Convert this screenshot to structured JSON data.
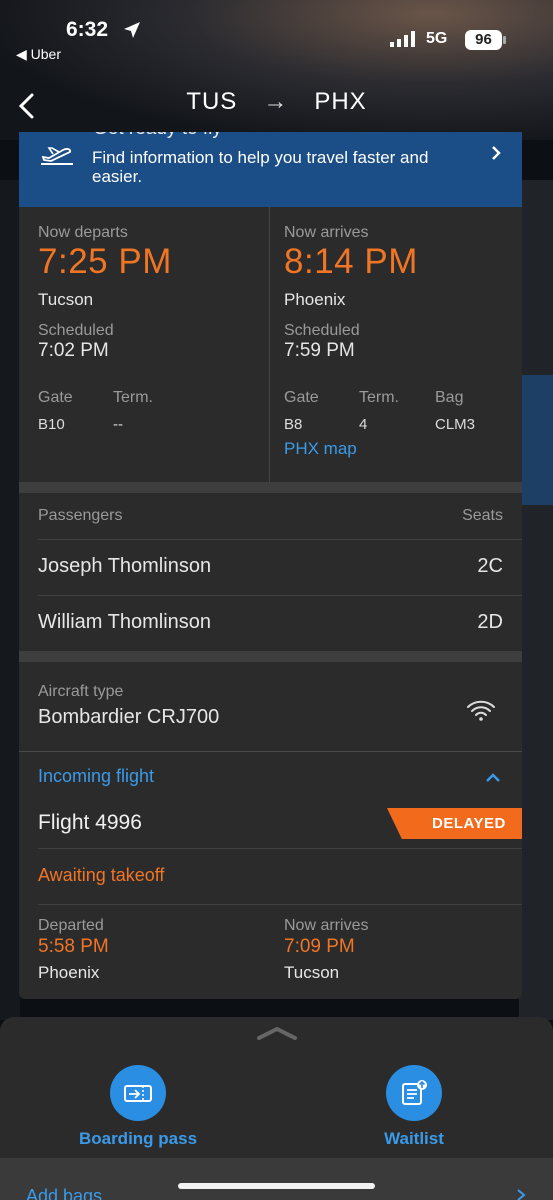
{
  "status_bar": {
    "time": "6:32",
    "back_app": "◀ Uber",
    "network": "5G",
    "battery": "96"
  },
  "header": {
    "origin": "TUS",
    "destination": "PHX"
  },
  "banner": {
    "title_clipped": "Get ready to fly",
    "text": "Find information to help you travel faster and easier."
  },
  "departure": {
    "label": "Now departs",
    "time": "7:25 PM",
    "city": "Tucson",
    "scheduled_label": "Scheduled",
    "scheduled": "7:02 PM",
    "gate_label": "Gate",
    "gate": "B10",
    "term_label": "Term.",
    "term": "--"
  },
  "arrival": {
    "label": "Now arrives",
    "time": "8:14 PM",
    "city": "Phoenix",
    "scheduled_label": "Scheduled",
    "scheduled": "7:59 PM",
    "gate_label": "Gate",
    "gate": "B8",
    "term_label": "Term.",
    "term": "4",
    "bag_label": "Bag",
    "bag": "CLM3",
    "map_link": "PHX map"
  },
  "passengers": {
    "header": "Passengers",
    "seats_header": "Seats",
    "rows": [
      {
        "name": "Joseph Thomlinson",
        "seat": "2C"
      },
      {
        "name": "William Thomlinson",
        "seat": "2D"
      }
    ]
  },
  "aircraft": {
    "label": "Aircraft type",
    "value": "Bombardier CRJ700"
  },
  "incoming": {
    "title": "Incoming flight",
    "flight": "Flight 4996",
    "badge": "DELAYED",
    "status": "Awaiting takeoff",
    "departed_label": "Departed",
    "departed_time": "5:58 PM",
    "departed_city": "Phoenix",
    "arrives_label": "Now arrives",
    "arrives_time": "7:09 PM",
    "arrives_city": "Tucson"
  },
  "actions": {
    "boarding_pass": "Boarding pass",
    "waitlist": "Waitlist",
    "add_bags": "Add bags"
  },
  "colors": {
    "accent_orange": "#f07524",
    "link_blue": "#3b9ae8",
    "banner_blue": "#1b4d86",
    "badge_orange": "#f26a1b"
  }
}
